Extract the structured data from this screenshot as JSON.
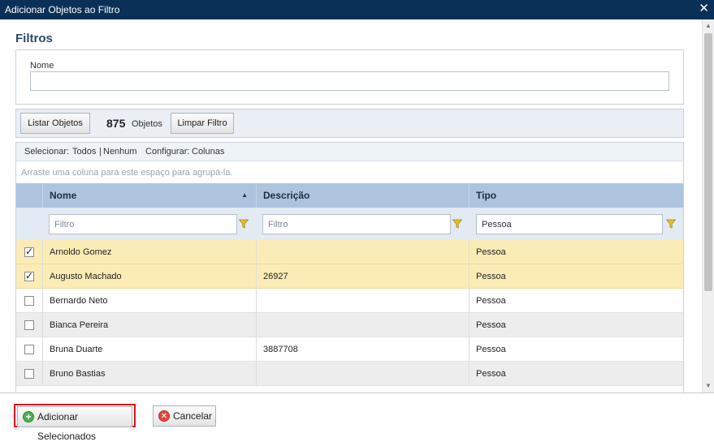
{
  "window": {
    "title": "Adicionar Objetos ao Filtro",
    "close_glyph": "✕"
  },
  "filters": {
    "title": "Filtros",
    "name_label": "Nome",
    "name_value": ""
  },
  "toolbar": {
    "list_button": "Listar Objetos",
    "count": "875",
    "count_label": "Objetos",
    "clear_button": "Limpar Filtro"
  },
  "grid": {
    "select_prefix": "Selecionar:",
    "select_all": "Todos",
    "separator": "|",
    "select_none": "Nenhum",
    "config_prefix": "Configurar:",
    "config_columns": "Colunas",
    "group_hint": "Arraste uma coluna para este espaço para agrupá-la.",
    "columns": [
      {
        "label": "Nome",
        "sort": "ascending"
      },
      {
        "label": "Descrição"
      },
      {
        "label": "Tipo"
      }
    ],
    "column_filters": [
      {
        "placeholder": "Filtro",
        "value": ""
      },
      {
        "placeholder": "Filtro",
        "value": ""
      },
      {
        "placeholder": "Filtro",
        "value": "Pessoa"
      }
    ],
    "rows": [
      {
        "checked": true,
        "nome": "Arnoldo Gomez",
        "descricao": "",
        "tipo": "Pessoa"
      },
      {
        "checked": true,
        "nome": "Augusto Machado",
        "descricao": "26927",
        "tipo": "Pessoa"
      },
      {
        "checked": false,
        "nome": "Bernardo Neto",
        "descricao": "",
        "tipo": "Pessoa"
      },
      {
        "checked": false,
        "nome": "Bianca Pereira",
        "descricao": "",
        "tipo": "Pessoa"
      },
      {
        "checked": false,
        "nome": "Bruna Duarte",
        "descricao": "3887708",
        "tipo": "Pessoa"
      },
      {
        "checked": false,
        "nome": "Bruno Bastias",
        "descricao": "",
        "tipo": "Pessoa"
      }
    ]
  },
  "footer": {
    "add_button": "Adicionar Selecionados",
    "cancel_button": "Cancelar"
  },
  "colors": {
    "titlebar": "#0b3058",
    "header": "#adc4de",
    "selected_row": "#fbecb6",
    "highlight": "#e01414",
    "funnel": "#e6c229"
  },
  "icons": [
    "close-icon",
    "filter-funnel-icon",
    "sort-asc-icon",
    "checkbox-icon",
    "add-icon",
    "cancel-icon"
  ]
}
